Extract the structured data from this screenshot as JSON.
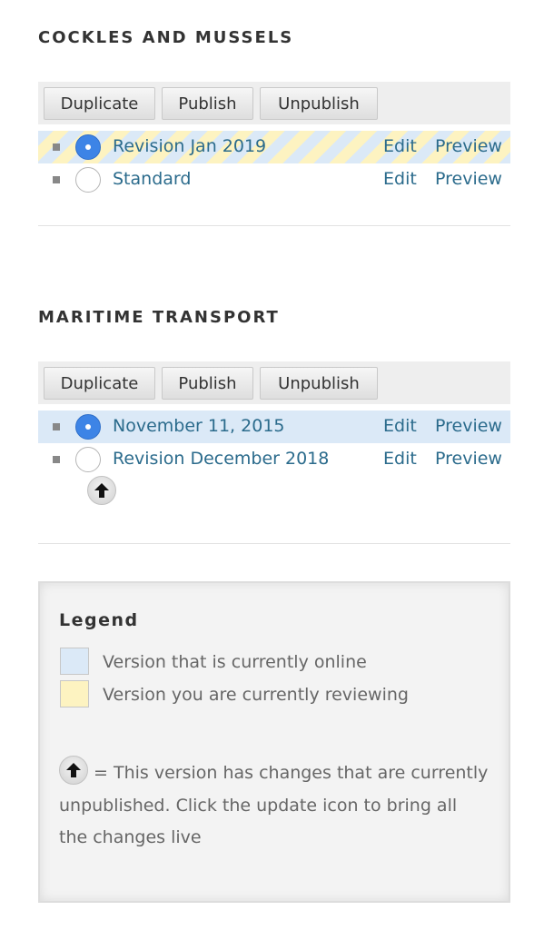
{
  "sections": [
    {
      "title": "COCKLES AND MUSSELS",
      "buttons": {
        "duplicate": "Duplicate",
        "publish": "Publish",
        "unpublish": "Unpublish"
      },
      "revisions": [
        {
          "label": "Revision Jan 2019",
          "selected": true,
          "state": "reviewing",
          "edit": "Edit",
          "preview": "Preview",
          "has_unpublished_changes": false
        },
        {
          "label": "Standard",
          "selected": false,
          "state": "none",
          "edit": "Edit",
          "preview": "Preview",
          "has_unpublished_changes": false
        }
      ]
    },
    {
      "title": "MARITIME TRANSPORT",
      "buttons": {
        "duplicate": "Duplicate",
        "publish": "Publish",
        "unpublish": "Unpublish"
      },
      "revisions": [
        {
          "label": "November 11, 2015",
          "selected": true,
          "state": "online",
          "edit": "Edit",
          "preview": "Preview",
          "has_unpublished_changes": false
        },
        {
          "label": "Revision December 2018",
          "selected": false,
          "state": "none",
          "edit": "Edit",
          "preview": "Preview",
          "has_unpublished_changes": true
        }
      ]
    }
  ],
  "legend": {
    "title": "Legend",
    "online": "Version that is currently online",
    "reviewing": "Version you are currently reviewing",
    "note": "= This version has changes that are currently unpublished. Click the update icon to bring all the changes live"
  },
  "icons": {
    "update": "up-arrow-icon",
    "radio_selected": "radio-selected-icon",
    "bullet": "square-bullet-icon"
  },
  "colors": {
    "online": "#dbe9f7",
    "reviewing": "#fdf3c1",
    "link": "#2b6b8c",
    "radio_selected": "#3d84e6"
  }
}
